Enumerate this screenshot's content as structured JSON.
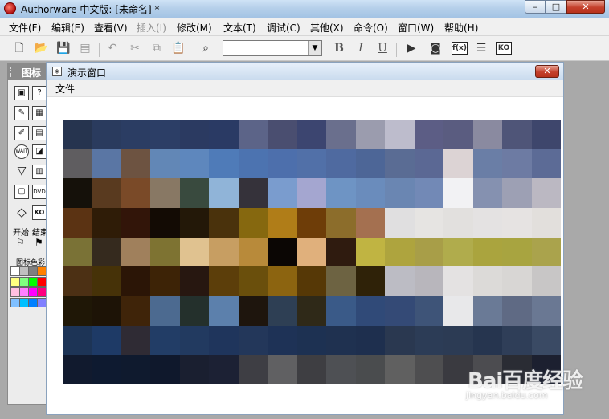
{
  "window": {
    "title": "Authorware 中文版: [未命名] *",
    "min_label": "–",
    "max_label": "□",
    "close_label": "✕"
  },
  "menubar": [
    {
      "label": "文件(F)",
      "enabled": true
    },
    {
      "label": "编辑(E)",
      "enabled": true
    },
    {
      "label": "查看(V)",
      "enabled": true
    },
    {
      "label": "插入(I)",
      "enabled": false
    },
    {
      "label": "修改(M)",
      "enabled": true
    },
    {
      "label": "文本(T)",
      "enabled": true
    },
    {
      "label": "调试(C)",
      "enabled": true
    },
    {
      "label": "其他(X)",
      "enabled": true
    },
    {
      "label": "命令(O)",
      "enabled": true
    },
    {
      "label": "窗口(W)",
      "enabled": true
    },
    {
      "label": "帮助(H)",
      "enabled": true
    }
  ],
  "toolbar": {
    "icons": [
      "new-file-icon",
      "open-file-icon",
      "save-all-icon",
      "import-icon",
      "undo-icon",
      "cut-icon",
      "copy-icon",
      "paste-icon",
      "find-icon",
      "bold-icon",
      "italic-icon",
      "underline-icon",
      "run-icon",
      "control-panel-icon",
      "functions-icon",
      "variables-icon",
      "knowledge-objects-icon"
    ],
    "font_value": "",
    "bold_label": "B",
    "italic_label": "I",
    "underline_label": "U",
    "functions_label": "f(x)",
    "knowledge_label": "KO"
  },
  "palette": {
    "title": "图标",
    "start_label": "开始",
    "end_label": "结束",
    "color_label": "图标色彩",
    "icons": [
      "display-icon",
      "motion-icon",
      "erase-icon",
      "wait-icon",
      "navigate-icon",
      "framework-icon",
      "decision-icon",
      "interaction-icon",
      "calculation-icon",
      "map-icon",
      "digital-movie-icon",
      "sound-icon",
      "video-icon",
      "knowledge-object-icon"
    ],
    "swatches": [
      "#ffffff",
      "#c0c0c0",
      "#808080",
      "#ff8000",
      "#ffff80",
      "#80ff80",
      "#00ff00",
      "#ff0000",
      "#ffc0e0",
      "#ff80ff",
      "#ff00ff",
      "#ff0080",
      "#80c0ff",
      "#00c0ff",
      "#0080ff",
      "#8080ff"
    ]
  },
  "presentation": {
    "title": "演示窗口",
    "menu_file": "文件",
    "close_label": "✕",
    "pixel_colors": [
      [
        "#26344f",
        "#2a3b5e",
        "#2b3d63",
        "#2c3e66",
        "#2b3a61",
        "#2a3a64",
        "#5c6488",
        "#4a4e70",
        "#3c4570",
        "#6a6f8d",
        "#9b9cae",
        "#bdbccc",
        "#5c5d85",
        "#5a5c80",
        "#8a8aa0",
        "#4f5578",
        "#3e466c"
      ],
      [
        "#5f5d60",
        "#5a76a4",
        "#6d5341",
        "#6287b6",
        "#5e87bd",
        "#4f7bb8",
        "#4c73b0",
        "#4d6fac",
        "#5170a8",
        "#4f6aa0",
        "#4d6697",
        "#5a6c94",
        "#5b6894",
        "#dcd3d4",
        "#6a7ea6",
        "#6d7ba3",
        "#5c6b96"
      ],
      [
        "#15110a",
        "#593a1f",
        "#7a4a28",
        "#887864",
        "#394a3e",
        "#90b4d8",
        "#35323a",
        "#7a9cce",
        "#a4a6d0",
        "#6e94c4",
        "#6a8cbc",
        "#6a86b2",
        "#7289b6",
        "#f2f2f4",
        "#8591b0",
        "#9da0b4",
        "#bbb8c2"
      ],
      [
        "#5b3313",
        "#2f1c07",
        "#321509",
        "#130b04",
        "#231808",
        "#4a320c",
        "#86680f",
        "#b07d18",
        "#6e3d08",
        "#8c6d2b",
        "#a47050",
        "#e0dfe0",
        "#e6e4e2",
        "#e2e0de",
        "#e4e2e2",
        "#e6e3e2",
        "#e2dfdc"
      ],
      [
        "#7a7236",
        "#352a1e",
        "#a0805c",
        "#7e7332",
        "#e0c290",
        "#c79e62",
        "#b88a3a",
        "#0b0604",
        "#e0b07c",
        "#2f1b0f",
        "#c0b442",
        "#aea43e",
        "#a89e48",
        "#b0ac4c",
        "#aaa43e",
        "#a8a440",
        "#aaa34c"
      ],
      [
        "#4c3014",
        "#463208",
        "#2b1506",
        "#3d2306",
        "#271710",
        "#5c3e0a",
        "#6a4f0c",
        "#8c6410",
        "#563806",
        "#6d6342",
        "#2f2208",
        "#bcbcc4",
        "#b8b6bc",
        "#e4e2e2",
        "#dcdad8",
        "#d8d6d4",
        "#c8c6c6"
      ],
      [
        "#1f1706",
        "#1d1306",
        "#3f2409",
        "#4c6a90",
        "#24302c",
        "#5c80ac",
        "#1e150d",
        "#2e3f54",
        "#2f2918",
        "#3a5a88",
        "#304a78",
        "#344a76",
        "#3e5478",
        "#e8e8ea",
        "#6a7a96",
        "#5f6a84",
        "#6a7893"
      ],
      [
        "#1d3456",
        "#1e3a66",
        "#2f2b34",
        "#223d66",
        "#223a60",
        "#1f355c",
        "#23375a",
        "#1e3256",
        "#1d3152",
        "#1f3150",
        "#1e2f4e",
        "#2a3850",
        "#2c3c56",
        "#2c3b54",
        "#26354f",
        "#2f3e58",
        "#3a4a64"
      ],
      [
        "#111a2e",
        "#0e1a30",
        "#0f1a2e",
        "#0f182c",
        "#1a1f30",
        "#1c2134",
        "#3e3e44",
        "#606062",
        "#3e3e42",
        "#4e5054",
        "#4a4c4e",
        "#606060",
        "#4e4e50",
        "#3a3a40",
        "#4c4c50",
        "#2a2c34",
        "#1c2030"
      ]
    ]
  },
  "watermark": {
    "brand": "Bai百度经验",
    "url": "jingyan.baidu.com"
  }
}
